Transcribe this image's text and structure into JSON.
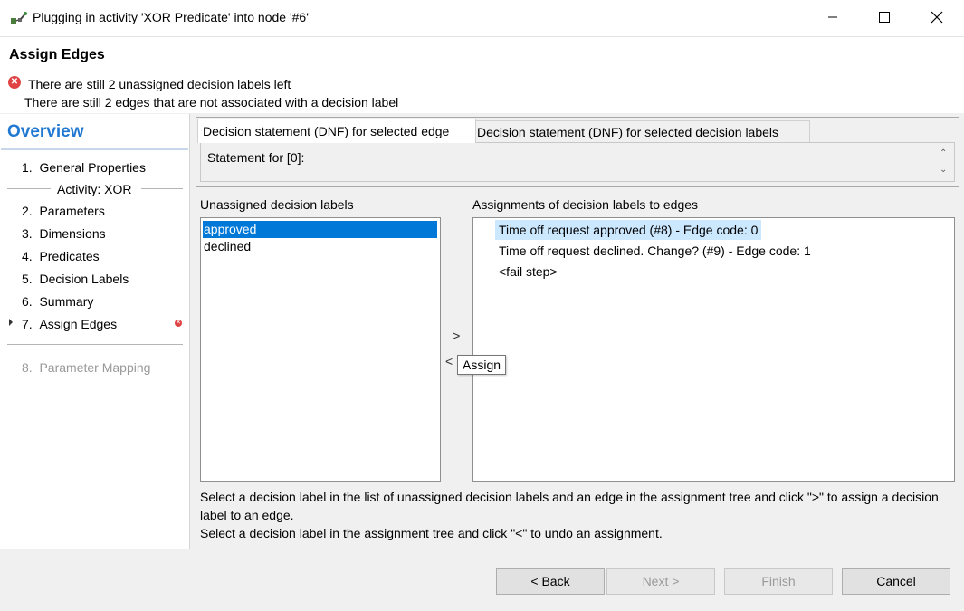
{
  "window": {
    "title": "Plugging in activity 'XOR Predicate' into node '#6'",
    "icon": "activity-plug-icon",
    "minimize_icon": "minimize-icon",
    "maximize_icon": "maximize-icon",
    "close_icon": "close-icon"
  },
  "header": {
    "title": "Assign Edges",
    "messages": [
      "There are still 2 unassigned decision labels left",
      "There are still 2 edges that are not associated with a decision label"
    ],
    "error_color": "#e04343"
  },
  "sidebar": {
    "title": "Overview",
    "steps": [
      {
        "num": "1.",
        "label": "General Properties"
      },
      {
        "num": "2.",
        "label": "Parameters"
      },
      {
        "num": "3.",
        "label": "Dimensions"
      },
      {
        "num": "4.",
        "label": "Predicates"
      },
      {
        "num": "5.",
        "label": "Decision Labels"
      },
      {
        "num": "6.",
        "label": "Summary"
      },
      {
        "num": "7.",
        "label": "Assign Edges"
      },
      {
        "num": "8.",
        "label": "Parameter Mapping"
      }
    ],
    "activity_label": "Activity: XOR",
    "current_step": "7."
  },
  "tabs": [
    {
      "label": "Decision statement (DNF) for selected edge",
      "active": true
    },
    {
      "label": "Decision statement (DNF) for selected decision labels",
      "active": false
    }
  ],
  "statement_label": "Statement for [0]:",
  "unassigned": {
    "title": "Unassigned decision labels",
    "items": [
      "approved",
      "declined"
    ],
    "selected": "approved"
  },
  "assignments": {
    "title": "Assignments of decision labels to edges",
    "nodes": [
      "Time off request approved (#8) - Edge code: 0",
      "Time off request declined. Change? (#9) - Edge code: 1",
      "<fail step>"
    ]
  },
  "assign_button": {
    "label": ">",
    "tooltip": "Assign"
  },
  "unassign_button": {
    "label": "<"
  },
  "help": {
    "line1": "Select a decision label in the list of unassigned decision labels and an edge in the assignment tree and click \">\" to assign a decision label to an edge.",
    "line2": "Select a decision label in the assignment tree and click \"<\" to undo an assignment."
  },
  "buttons": {
    "back": "< Back",
    "next": "Next >",
    "finish": "Finish",
    "cancel": "Cancel"
  },
  "colors": {
    "accent": "#1f78d1",
    "selection": "#0078d7",
    "tree_selection": "#cce8ff"
  }
}
